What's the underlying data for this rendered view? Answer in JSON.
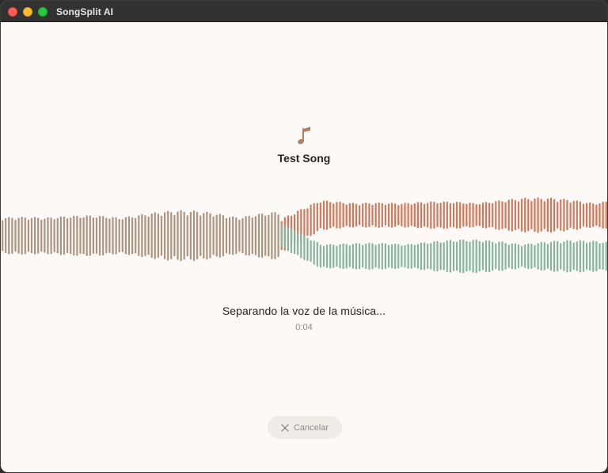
{
  "window": {
    "title": "SongSplit AI"
  },
  "track": {
    "title": "Test Song",
    "icon": "music-note-icon"
  },
  "progress": {
    "status": "Separando la voz de la música...",
    "elapsed": "0:04",
    "split_fraction": 0.46
  },
  "actions": {
    "cancel_label": "Cancelar",
    "cancel_icon": "close-icon"
  },
  "colors": {
    "background": "#fcf9f6",
    "original_wave": "#a99582",
    "vocals_wave": "#cf7a5d",
    "music_wave": "#86b4a1",
    "icon_accent": "#b08060"
  }
}
